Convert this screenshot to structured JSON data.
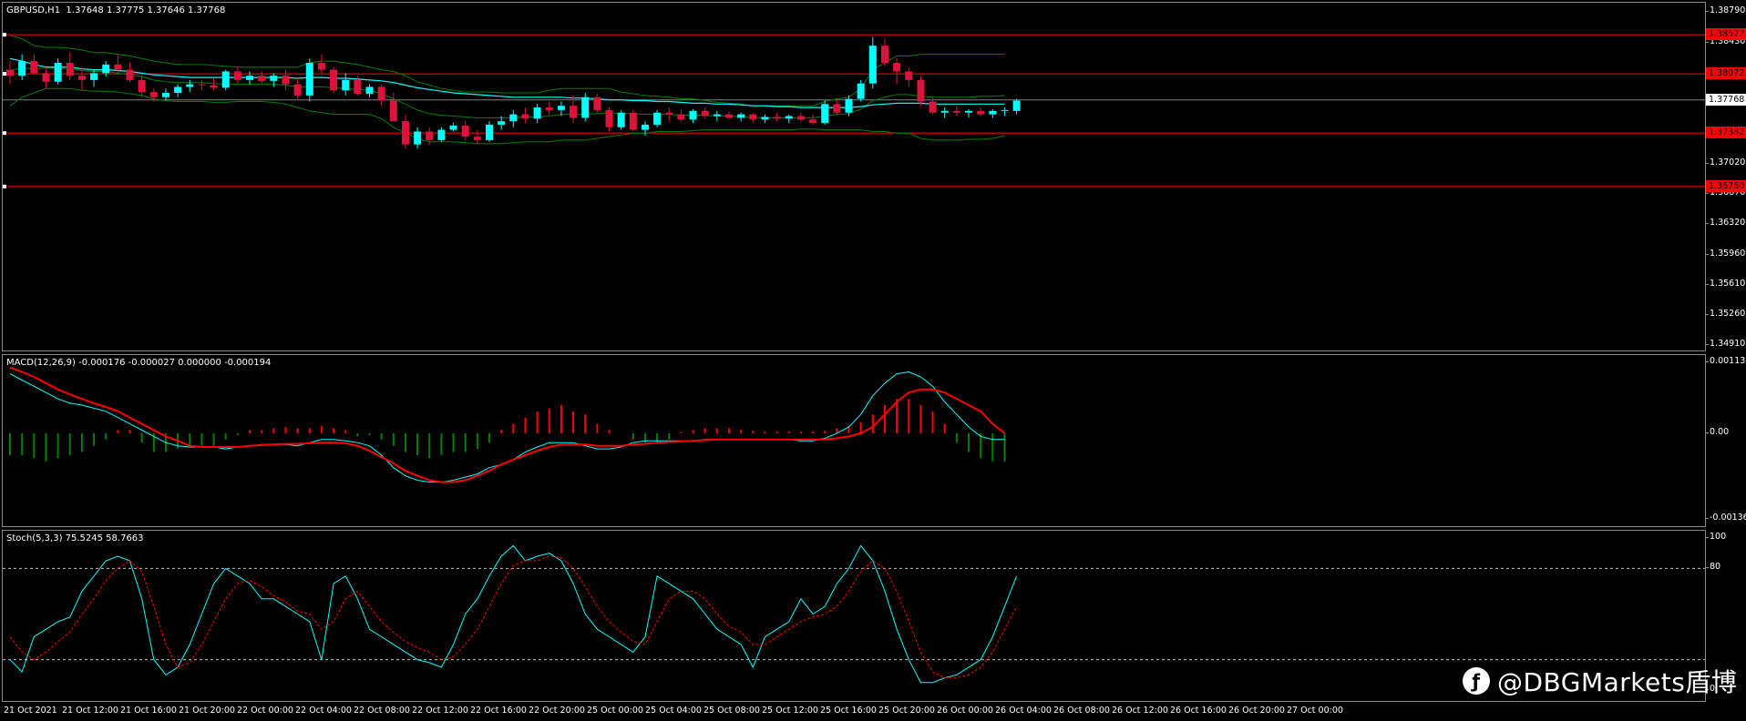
{
  "main": {
    "label": "GBPUSD,H1  1.37648 1.37775 1.37646 1.37768",
    "symbol": "GBPUSD",
    "timeframe": "H1",
    "ohlc": [
      1.37648,
      1.37775,
      1.37646,
      1.37768
    ],
    "price_axis": [
      "1.38790",
      "1.38430",
      "1.37720",
      "1.37020",
      "1.36670",
      "1.36320",
      "1.35960",
      "1.35610",
      "1.35260",
      "1.34910"
    ],
    "current_price": "1.37768",
    "levels": [
      {
        "label": "1.38527",
        "price": 1.38527,
        "color": "#ff0000"
      },
      {
        "label": "1.38072",
        "price": 1.38072,
        "color": "#ff0000"
      },
      {
        "label": "1.37382",
        "price": 1.37382,
        "color": "#ff0000"
      },
      {
        "label": "1.36760",
        "price": 1.3676,
        "color": "#ff0000"
      }
    ],
    "candles": [
      [
        1.3812,
        1.3822,
        1.3795,
        1.3805
      ],
      [
        1.3805,
        1.383,
        1.38,
        1.3822
      ],
      [
        1.3822,
        1.383,
        1.3806,
        1.3808
      ],
      [
        1.3808,
        1.3815,
        1.379,
        1.3798
      ],
      [
        1.3798,
        1.3825,
        1.3795,
        1.382
      ],
      [
        1.382,
        1.3832,
        1.38,
        1.3805
      ],
      [
        1.3805,
        1.3815,
        1.3788,
        1.38
      ],
      [
        1.38,
        1.3812,
        1.3792,
        1.3808
      ],
      [
        1.3808,
        1.3822,
        1.3804,
        1.3818
      ],
      [
        1.3818,
        1.383,
        1.3808,
        1.3812
      ],
      [
        1.3812,
        1.382,
        1.3798,
        1.38
      ],
      [
        1.38,
        1.3805,
        1.378,
        1.3786
      ],
      [
        1.3786,
        1.379,
        1.3775,
        1.378
      ],
      [
        1.378,
        1.379,
        1.3776,
        1.3785
      ],
      [
        1.3785,
        1.3795,
        1.378,
        1.3792
      ],
      [
        1.3792,
        1.38,
        1.3786,
        1.3795
      ],
      [
        1.3795,
        1.38,
        1.3788,
        1.3794
      ],
      [
        1.3794,
        1.3802,
        1.3788,
        1.3791
      ],
      [
        1.3791,
        1.3812,
        1.3788,
        1.381
      ],
      [
        1.381,
        1.3815,
        1.3795,
        1.38
      ],
      [
        1.38,
        1.381,
        1.3795,
        1.3805
      ],
      [
        1.3805,
        1.381,
        1.3795,
        1.3799
      ],
      [
        1.3799,
        1.3808,
        1.3792,
        1.3805
      ],
      [
        1.3805,
        1.3812,
        1.3788,
        1.3795
      ],
      [
        1.3795,
        1.3802,
        1.3778,
        1.3782
      ],
      [
        1.3782,
        1.3825,
        1.3775,
        1.382
      ],
      [
        1.382,
        1.383,
        1.3808,
        1.3812
      ],
      [
        1.3812,
        1.3815,
        1.3785,
        1.3788
      ],
      [
        1.3788,
        1.3808,
        1.3782,
        1.38
      ],
      [
        1.38,
        1.3805,
        1.3782,
        1.3784
      ],
      [
        1.3784,
        1.3795,
        1.378,
        1.3792
      ],
      [
        1.3792,
        1.3795,
        1.377,
        1.3776
      ],
      [
        1.3776,
        1.3785,
        1.3758,
        1.3752
      ],
      [
        1.3752,
        1.376,
        1.372,
        1.3725
      ],
      [
        1.3725,
        1.3745,
        1.372,
        1.374
      ],
      [
        1.374,
        1.3745,
        1.3725,
        1.373
      ],
      [
        1.373,
        1.3745,
        1.3728,
        1.3742
      ],
      [
        1.3742,
        1.375,
        1.374,
        1.3747
      ],
      [
        1.3747,
        1.3752,
        1.373,
        1.3734
      ],
      [
        1.3734,
        1.3742,
        1.3725,
        1.373
      ],
      [
        1.373,
        1.3752,
        1.3728,
        1.3748
      ],
      [
        1.3748,
        1.3758,
        1.3742,
        1.3752
      ],
      [
        1.3752,
        1.3765,
        1.3745,
        1.376
      ],
      [
        1.376,
        1.3768,
        1.375,
        1.3755
      ],
      [
        1.3755,
        1.3772,
        1.375,
        1.3768
      ],
      [
        1.3768,
        1.3775,
        1.376,
        1.3765
      ],
      [
        1.3765,
        1.3775,
        1.3758,
        1.377
      ],
      [
        1.377,
        1.3782,
        1.375,
        1.3756
      ],
      [
        1.3756,
        1.3785,
        1.3752,
        1.378
      ],
      [
        1.378,
        1.3784,
        1.3762,
        1.3765
      ],
      [
        1.3765,
        1.3768,
        1.374,
        1.3745
      ],
      [
        1.3745,
        1.3765,
        1.3742,
        1.3762
      ],
      [
        1.3762,
        1.3765,
        1.374,
        1.3742
      ],
      [
        1.3742,
        1.3752,
        1.3735,
        1.3748
      ],
      [
        1.3748,
        1.3765,
        1.3745,
        1.3762
      ],
      [
        1.3762,
        1.3768,
        1.3752,
        1.376
      ],
      [
        1.376,
        1.3766,
        1.3752,
        1.3754
      ],
      [
        1.3754,
        1.3766,
        1.375,
        1.3764
      ],
      [
        1.3764,
        1.3768,
        1.3755,
        1.3758
      ],
      [
        1.3758,
        1.3764,
        1.3752,
        1.376
      ],
      [
        1.376,
        1.3763,
        1.3754,
        1.3756
      ],
      [
        1.3756,
        1.3762,
        1.3752,
        1.376
      ],
      [
        1.376,
        1.3762,
        1.375,
        1.3754
      ],
      [
        1.3754,
        1.376,
        1.375,
        1.3757
      ],
      [
        1.3757,
        1.3762,
        1.3752,
        1.3755
      ],
      [
        1.3755,
        1.376,
        1.375,
        1.3758
      ],
      [
        1.3758,
        1.3762,
        1.3752,
        1.3754
      ],
      [
        1.3754,
        1.376,
        1.3748,
        1.375
      ],
      [
        1.375,
        1.3776,
        1.3748,
        1.3772
      ],
      [
        1.3772,
        1.3778,
        1.376,
        1.3762
      ],
      [
        1.3762,
        1.3782,
        1.3758,
        1.3778
      ],
      [
        1.3778,
        1.38,
        1.3775,
        1.3796
      ],
      [
        1.3796,
        1.385,
        1.379,
        1.384
      ],
      [
        1.384,
        1.3848,
        1.3816,
        1.382
      ],
      [
        1.382,
        1.3825,
        1.3795,
        1.381
      ],
      [
        1.381,
        1.3815,
        1.3792,
        1.38
      ],
      [
        1.38,
        1.3805,
        1.377,
        1.3775
      ],
      [
        1.3775,
        1.378,
        1.376,
        1.3762
      ],
      [
        1.3762,
        1.3768,
        1.3756,
        1.3764
      ],
      [
        1.3764,
        1.377,
        1.3758,
        1.3762
      ],
      [
        1.3762,
        1.3766,
        1.3756,
        1.3764
      ],
      [
        1.3764,
        1.3768,
        1.3758,
        1.376
      ],
      [
        1.376,
        1.3766,
        1.3756,
        1.3764
      ],
      [
        1.3764,
        1.3768,
        1.3758,
        1.3765
      ],
      [
        1.3764,
        1.3778,
        1.376,
        1.3776
      ]
    ],
    "bb_upper": [
      1.3852,
      1.3848,
      1.384,
      1.3838,
      1.3838,
      1.3837,
      1.3835,
      1.3832,
      1.3832,
      1.383,
      1.3828,
      1.3825,
      1.3822,
      1.382,
      1.3818,
      1.3818,
      1.3818,
      1.3817,
      1.3816,
      1.3815,
      1.3815,
      1.3815,
      1.3815,
      1.3815,
      1.3815,
      1.382,
      1.3822,
      1.3822,
      1.382,
      1.3818,
      1.3815,
      1.3812,
      1.381,
      1.3805,
      1.3798,
      1.3794,
      1.379,
      1.3788,
      1.3786,
      1.3786,
      1.3786,
      1.3785,
      1.3785,
      1.3785,
      1.3785,
      1.3788,
      1.379,
      1.379,
      1.379,
      1.379,
      1.379,
      1.3786,
      1.3784,
      1.3782,
      1.3781,
      1.378,
      1.3778,
      1.3778,
      1.3776,
      1.3774,
      1.3773,
      1.3772,
      1.377,
      1.377,
      1.377,
      1.377,
      1.377,
      1.377,
      1.3775,
      1.3778,
      1.378,
      1.379,
      1.3812,
      1.382,
      1.3828,
      1.3828,
      1.383,
      1.383,
      1.383,
      1.383,
      1.383,
      1.383,
      1.383,
      1.383
    ],
    "bb_lower": [
      1.377,
      1.378,
      1.3785,
      1.379,
      1.379,
      1.379,
      1.3788,
      1.3787,
      1.3787,
      1.3786,
      1.3784,
      1.3782,
      1.3778,
      1.3776,
      1.3775,
      1.3775,
      1.3775,
      1.3774,
      1.3774,
      1.3775,
      1.3775,
      1.3775,
      1.3774,
      1.3772,
      1.3768,
      1.3764,
      1.3762,
      1.376,
      1.376,
      1.376,
      1.376,
      1.3755,
      1.3745,
      1.3738,
      1.3732,
      1.3728,
      1.3728,
      1.3728,
      1.3727,
      1.3726,
      1.3726,
      1.3726,
      1.3727,
      1.3728,
      1.3728,
      1.3728,
      1.373,
      1.373,
      1.373,
      1.3732,
      1.3734,
      1.3736,
      1.3738,
      1.3738,
      1.374,
      1.374,
      1.374,
      1.3741,
      1.3742,
      1.3742,
      1.3742,
      1.3742,
      1.3742,
      1.3742,
      1.3742,
      1.3742,
      1.3743,
      1.3743,
      1.3742,
      1.3742,
      1.3742,
      1.3742,
      1.374,
      1.374,
      1.3738,
      1.3738,
      1.3732,
      1.373,
      1.373,
      1.373,
      1.3731,
      1.3731,
      1.3732,
      1.3735
    ],
    "bb_mid": [
      1.3811,
      1.3814,
      1.3813,
      1.3814,
      1.3814,
      1.3813,
      1.3811,
      1.381,
      1.381,
      1.3808,
      1.3806,
      1.3804,
      1.38,
      1.3798,
      1.3797,
      1.3797,
      1.3797,
      1.3796,
      1.3795,
      1.3795,
      1.3795,
      1.3795,
      1.3795,
      1.3794,
      1.3792,
      1.3792,
      1.3792,
      1.3791,
      1.379,
      1.3789,
      1.3788,
      1.3784,
      1.3778,
      1.3772,
      1.3765,
      1.3761,
      1.3759,
      1.3758,
      1.3757,
      1.3756,
      1.3756,
      1.3756,
      1.3756,
      1.3757,
      1.3757,
      1.3758,
      1.376,
      1.376,
      1.376,
      1.3761,
      1.3762,
      1.3761,
      1.3761,
      1.376,
      1.376,
      1.376,
      1.3759,
      1.3759,
      1.3759,
      1.3758,
      1.3758,
      1.3757,
      1.3756,
      1.3756,
      1.3756,
      1.3756,
      1.3756,
      1.3756,
      1.3758,
      1.376,
      1.3761,
      1.3766,
      1.3776,
      1.378,
      1.3783,
      1.3783,
      1.3781,
      1.378,
      1.378,
      1.378,
      1.378,
      1.3781,
      1.3781,
      1.3782
    ],
    "ma": [
      1.3825,
      1.3822,
      1.3818,
      1.3815,
      1.3815,
      1.3815,
      1.3813,
      1.3812,
      1.3812,
      1.3811,
      1.381,
      1.3808,
      1.3806,
      1.3805,
      1.3804,
      1.3803,
      1.3803,
      1.3803,
      1.3803,
      1.3803,
      1.3803,
      1.3803,
      1.3803,
      1.3803,
      1.3802,
      1.3803,
      1.3803,
      1.3802,
      1.3802,
      1.3801,
      1.38,
      1.3799,
      1.3797,
      1.3794,
      1.3791,
      1.3789,
      1.3787,
      1.3785,
      1.3784,
      1.3783,
      1.3782,
      1.3781,
      1.378,
      1.378,
      1.378,
      1.378,
      1.378,
      1.3779,
      1.3779,
      1.3778,
      1.3777,
      1.3777,
      1.3776,
      1.3776,
      1.3775,
      1.3775,
      1.3774,
      1.3773,
      1.3773,
      1.3772,
      1.3772,
      1.3771,
      1.377,
      1.377,
      1.3769,
      1.3769,
      1.3768,
      1.3768,
      1.3768,
      1.3768,
      1.3768,
      1.3769,
      1.3771,
      1.3772,
      1.3773,
      1.3773,
      1.3773,
      1.3772,
      1.3772,
      1.3772,
      1.3772,
      1.3772,
      1.3772,
      1.3772
    ]
  },
  "macd": {
    "label": "MACD(12,26,9) -0.000176 -0.000027 0.000000 -0.000194",
    "axis": [
      "0.001133",
      "0.00",
      "-0.001368"
    ],
    "hist": [
      -0.00035,
      -0.00035,
      -0.0004,
      -0.00045,
      -0.0004,
      -0.00035,
      -0.0003,
      -0.0002,
      -0.0001,
      5e-05,
      5e-05,
      -0.00015,
      -0.0003,
      -0.0003,
      -0.00025,
      -0.0002,
      -0.0002,
      -0.0002,
      -0.0001,
      -3e-05,
      5e-05,
      5e-05,
      8e-05,
      0.0001,
      8e-05,
      8e-05,
      0.00012,
      8e-05,
      5e-05,
      -5e-05,
      -3e-05,
      -0.0001,
      -0.0002,
      -0.0003,
      -0.00035,
      -0.0004,
      -0.00035,
      -0.0003,
      -0.0003,
      -0.00025,
      -0.00015,
      5e-05,
      0.00015,
      0.00025,
      0.00035,
      0.0004,
      0.00045,
      0.00035,
      0.0003,
      0.00015,
      5e-05,
      0,
      -0.0001,
      -0.00015,
      -0.00015,
      -0.0001,
      2e-05,
      5e-05,
      8e-05,
      8e-05,
      8e-05,
      6e-05,
      4e-05,
      3e-05,
      3e-05,
      3e-05,
      3e-05,
      3e-05,
      4e-05,
      8e-05,
      0.00012,
      0.00018,
      0.0003,
      0.00045,
      0.00055,
      0.00055,
      0.00045,
      0.00035,
      0.00015,
      -0.00015,
      -0.0003,
      -0.0004,
      -0.00045,
      -0.00045
    ],
    "main_line": [
      0.00095,
      0.00085,
      0.00075,
      0.00065,
      0.00055,
      0.00048,
      0.00045,
      0.0004,
      0.00035,
      0.00025,
      0.00015,
      5e-05,
      -5e-05,
      -0.00015,
      -0.0002,
      -0.00022,
      -0.00022,
      -0.00022,
      -0.00025,
      -0.00022,
      -0.0002,
      -0.00018,
      -0.00018,
      -0.00018,
      -0.0002,
      -0.00015,
      -0.0001,
      -0.0001,
      -0.00012,
      -0.00015,
      -0.0002,
      -0.00035,
      -0.00055,
      -0.00068,
      -0.00075,
      -0.00078,
      -0.00078,
      -0.00075,
      -0.0007,
      -0.00065,
      -0.00055,
      -0.0005,
      -0.00042,
      -0.0003,
      -0.00022,
      -0.00015,
      -0.00015,
      -0.00015,
      -0.0002,
      -0.00025,
      -0.00025,
      -0.00022,
      -0.00015,
      -0.00012,
      -0.00012,
      -0.00012,
      -0.00012,
      -0.00012,
      -0.0001,
      -0.0001,
      -0.0001,
      -0.0001,
      -0.0001,
      -0.0001,
      -0.0001,
      -0.0001,
      -0.00012,
      -0.00012,
      -8e-05,
      0.0,
      0.0001,
      0.0003,
      0.0006,
      0.0008,
      0.00095,
      0.00098,
      0.0009,
      0.00075,
      0.0005,
      0.0003,
      0.0001,
      -5e-05,
      -0.0001,
      -0.0001
    ],
    "signal_line": [
      0.00105,
      0.00098,
      0.0009,
      0.0008,
      0.0007,
      0.00062,
      0.00055,
      0.00048,
      0.00042,
      0.00035,
      0.00025,
      0.00015,
      5e-05,
      -5e-05,
      -0.00012,
      -0.0002,
      -0.00022,
      -0.00022,
      -0.00022,
      -0.00022,
      -0.0002,
      -0.00019,
      -0.00018,
      -0.00017,
      -0.00017,
      -0.00016,
      -0.00015,
      -0.00015,
      -0.00016,
      -0.0002,
      -0.00028,
      -0.00038,
      -0.00048,
      -0.0006,
      -0.00068,
      -0.00075,
      -0.00078,
      -0.00078,
      -0.00075,
      -0.00068,
      -0.0006,
      -0.0005,
      -0.00042,
      -0.00035,
      -0.00028,
      -0.00022,
      -0.00018,
      -0.00018,
      -0.00018,
      -0.0002,
      -0.0002,
      -0.0002,
      -0.00018,
      -0.00017,
      -0.00015,
      -0.00014,
      -0.00013,
      -0.00012,
      -0.00011,
      -0.0001,
      -0.0001,
      -0.0001,
      -0.0001,
      -0.0001,
      -0.0001,
      -0.0001,
      -0.0001,
      -0.0001,
      -0.0001,
      -8e-05,
      -5e-05,
      0.0,
      0.0001,
      0.0003,
      0.0005,
      0.00065,
      0.0007,
      0.0007,
      0.00065,
      0.00055,
      0.00045,
      0.00035,
      0.00015,
      0.0
    ]
  },
  "stoch": {
    "label": "Stoch(5,3,3) 75.5245 58.7663",
    "axis": [
      "100",
      "80",
      "0"
    ],
    "levels": [
      80,
      20
    ],
    "k": [
      20,
      12,
      35,
      40,
      45,
      48,
      65,
      75,
      85,
      88,
      85,
      60,
      20,
      10,
      15,
      30,
      50,
      70,
      80,
      75,
      70,
      60,
      60,
      55,
      50,
      45,
      20,
      70,
      75,
      60,
      40,
      35,
      30,
      25,
      20,
      18,
      15,
      30,
      50,
      60,
      75,
      88,
      95,
      85,
      88,
      90,
      85,
      70,
      50,
      40,
      35,
      30,
      25,
      35,
      75,
      70,
      65,
      60,
      50,
      40,
      35,
      30,
      15,
      35,
      40,
      45,
      60,
      50,
      55,
      70,
      80,
      95,
      85,
      65,
      40,
      20,
      5,
      5,
      8,
      10,
      15,
      20,
      35,
      55,
      75
    ],
    "d": [
      35,
      25,
      20,
      25,
      32,
      38,
      50,
      60,
      72,
      80,
      85,
      78,
      55,
      30,
      15,
      18,
      30,
      45,
      60,
      70,
      72,
      68,
      62,
      58,
      52,
      50,
      40,
      45,
      60,
      65,
      55,
      45,
      38,
      32,
      28,
      25,
      20,
      22,
      30,
      40,
      55,
      70,
      82,
      85,
      85,
      88,
      87,
      80,
      68,
      55,
      45,
      38,
      32,
      30,
      45,
      60,
      65,
      65,
      60,
      50,
      42,
      38,
      30,
      30,
      35,
      40,
      45,
      48,
      50,
      55,
      65,
      78,
      85,
      80,
      65,
      45,
      25,
      12,
      8,
      8,
      10,
      15,
      25,
      40,
      55
    ]
  },
  "time_axis": [
    "21 Oct 2021",
    "21 Oct 12:00",
    "21 Oct 16:00",
    "21 Oct 20:00",
    "22 Oct 00:00",
    "22 Oct 04:00",
    "22 Oct 08:00",
    "22 Oct 12:00",
    "22 Oct 16:00",
    "22 Oct 20:00",
    "25 Oct 00:00",
    "25 Oct 04:00",
    "25 Oct 08:00",
    "25 Oct 12:00",
    "25 Oct 16:00",
    "25 Oct 20:00",
    "26 Oct 00:00",
    "26 Oct 04:00",
    "26 Oct 08:00",
    "26 Oct 12:00",
    "26 Oct 16:00",
    "26 Oct 20:00",
    "27 Oct 00:00"
  ],
  "watermark": "@DBGMarkets盾博",
  "colors": {
    "bull": "#00ffff",
    "bear": "#dc143c",
    "level": "#ff0000",
    "bands": "#008000",
    "ma": "#00ffff",
    "macd_pos": "#ff0000",
    "macd_neg": "#008000",
    "signal": "#ff0000",
    "stoch_k": "#00ffff",
    "stoch_d": "#ff0000"
  }
}
